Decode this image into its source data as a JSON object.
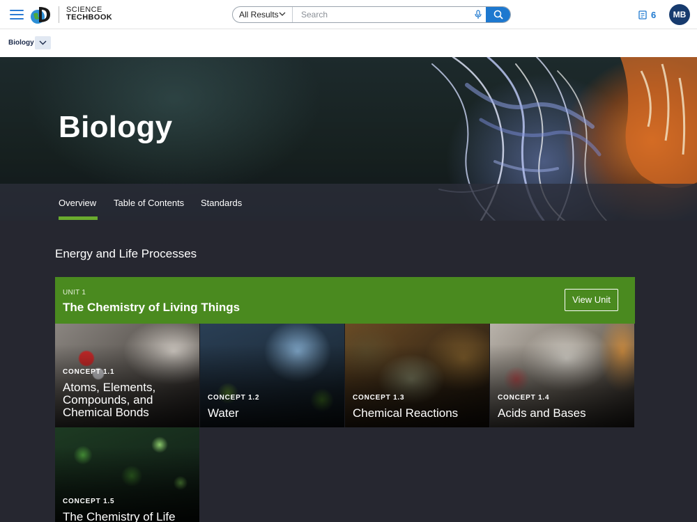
{
  "header": {
    "brand_line1": "SCIENCE",
    "brand_line2": "TECHBOOK",
    "search_scope": "All Results",
    "search_placeholder": "Search",
    "notes_count": "6",
    "avatar_initials": "MB",
    "accent_color": "#1d78cf"
  },
  "breadcrumb": {
    "label": "Biology"
  },
  "hero": {
    "title": "Biology",
    "tabs": [
      "Overview",
      "Table of Contents",
      "Standards"
    ],
    "active_tab": "Overview",
    "active_color": "#6aab2e"
  },
  "main": {
    "section_title": "Energy and Life Processes",
    "unit": {
      "label": "UNIT 1",
      "title": "The Chemistry of Living Things",
      "button": "View Unit",
      "color": "#4a8a1f"
    },
    "concepts": [
      {
        "label": "CONCEPT 1.1",
        "title": "Atoms, Elements, Compounds, and Chemical Bonds"
      },
      {
        "label": "CONCEPT 1.2",
        "title": "Water"
      },
      {
        "label": "CONCEPT 1.3",
        "title": "Chemical Reactions"
      },
      {
        "label": "CONCEPT 1.4",
        "title": "Acids and Bases"
      },
      {
        "label": "CONCEPT 1.5",
        "title": "The Chemistry of Life"
      }
    ]
  }
}
